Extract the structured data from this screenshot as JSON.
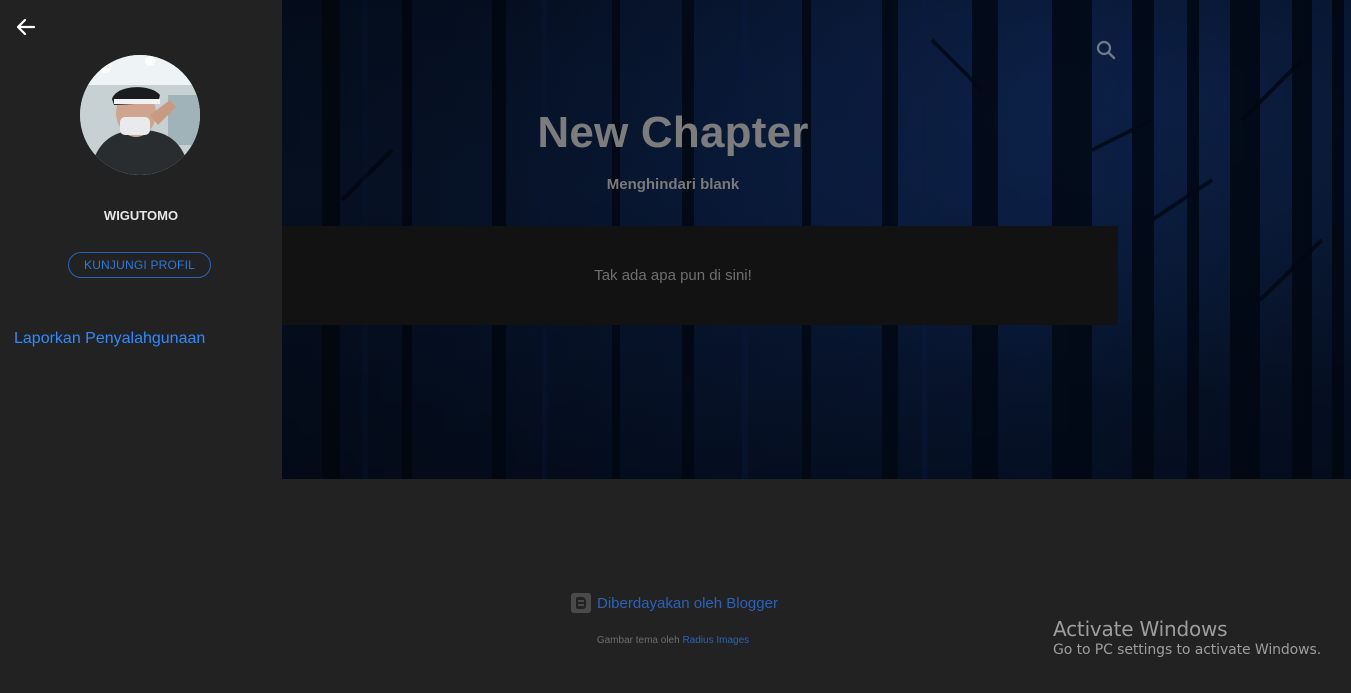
{
  "blog": {
    "title": "New Chapter",
    "description": "Menghindari blank",
    "empty_message": "Tak ada apa pun di sini!"
  },
  "header": {
    "search_icon": "search-icon"
  },
  "sidebar": {
    "back_icon": "arrow-back-icon",
    "profile_name": "WIGUTOMO",
    "visit_profile_label": "KUNJUNGI PROFIL",
    "report_abuse_label": "Laporkan Penyalahgunaan"
  },
  "footer": {
    "powered_by": "Diberdayakan oleh Blogger",
    "theme_credit_prefix": "Gambar tema oleh ",
    "theme_credit_link": "Radius Images"
  },
  "system_watermark": {
    "title": "Activate Windows",
    "subtitle": "Go to PC settings to activate Windows."
  },
  "colors": {
    "accent": "#2a63b8",
    "link": "#2f8bff",
    "background": "#222222",
    "hero": "#0a1c3a"
  }
}
